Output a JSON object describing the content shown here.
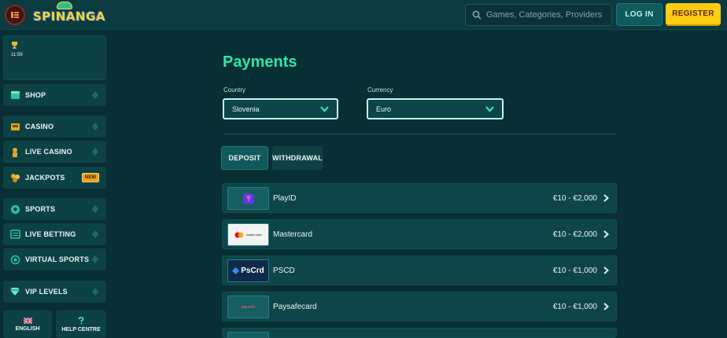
{
  "header": {
    "search_placeholder": "Games, Categories, Providers",
    "login_label": "LOG IN",
    "register_label": "REGISTER"
  },
  "sidebar": {
    "widget_time": "11:59",
    "items": [
      {
        "label": "SHOP",
        "icon": "shop-icon"
      },
      {
        "label": "CASINO",
        "icon": "casino-icon"
      },
      {
        "label": "LIVE CASINO",
        "icon": "live-casino-icon"
      },
      {
        "label": "JACKPOTS",
        "icon": "jackpots-icon",
        "badge": "NEW"
      },
      {
        "label": "SPORTS",
        "icon": "soccer-ball-icon"
      },
      {
        "label": "LIVE BETTING",
        "icon": "live-betting-icon"
      },
      {
        "label": "VIRTUAL SPORTS",
        "icon": "virtual-sports-icon"
      },
      {
        "label": "VIP LEVELS",
        "icon": "diamond-icon"
      }
    ],
    "language_label": "ENGLISH",
    "help_label": "HELP CENTRE"
  },
  "main": {
    "title": "Payments",
    "country_label": "Country",
    "country_value": "Slovenia",
    "currency_label": "Currency",
    "currency_value": "Euro",
    "tabs": [
      {
        "label": "DEPOSIT",
        "active": true
      },
      {
        "label": "WITHDRAWAL",
        "active": false
      }
    ],
    "methods": [
      {
        "name": "PlayID",
        "range": "€10 - €2,000",
        "logo": "playid-logo"
      },
      {
        "name": "Mastercard",
        "range": "€10 - €2,000",
        "logo": "mastercard-logo",
        "logo_text": "mastercard"
      },
      {
        "name": "PSCD",
        "range": "€10 - €1,000",
        "logo": "pscd-logo",
        "logo_text": "PsCrd"
      },
      {
        "name": "Paysafecard",
        "range": "€10 - €1,000",
        "logo": "paysafecard-logo",
        "logo_text": "paysafe"
      }
    ]
  },
  "colors": {
    "background": "#082f33",
    "accent_green": "#2ee6a8",
    "register_yellow": "#ffcc14"
  }
}
